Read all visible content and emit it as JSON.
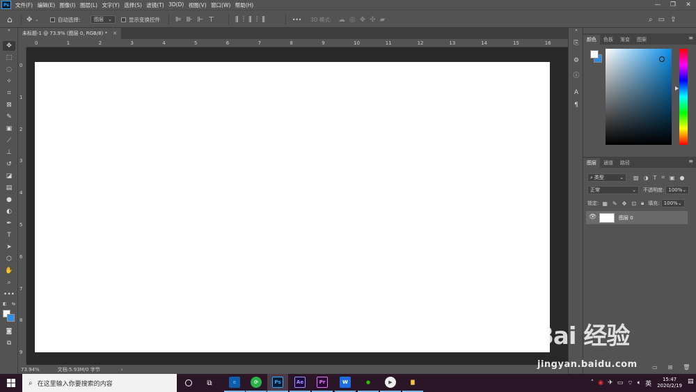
{
  "app": {
    "logo_text": "Ps",
    "menus": [
      "文件(F)",
      "编辑(E)",
      "图像(I)",
      "图层(L)",
      "文字(Y)",
      "选择(S)",
      "滤镜(T)",
      "3D(D)",
      "视图(V)",
      "窗口(W)",
      "帮助(H)"
    ]
  },
  "options_bar": {
    "auto_select_label": "自动选择:",
    "auto_select_target": "图层",
    "show_transform_label": "显示变换控件",
    "more_label": "•••",
    "mode_3d_label": "3D 模式:"
  },
  "document": {
    "tab_title": "未标题-1 @ 73.9% (图层 0, RGB/8) *",
    "zoom": "73.94%",
    "doc_info": "文档:5.93M/0 字节",
    "ruler_top": [
      "0",
      "1",
      "2",
      "3",
      "4",
      "5",
      "6",
      "7",
      "8",
      "9",
      "10",
      "11",
      "12",
      "13",
      "14",
      "15",
      "16"
    ],
    "ruler_left": [
      "0",
      "1",
      "2",
      "3",
      "4",
      "5",
      "6",
      "7",
      "8",
      "9"
    ],
    "canvas_color": "#ffffff"
  },
  "color_panel": {
    "tabs": [
      "颜色",
      "色板",
      "渐变",
      "图案"
    ],
    "foreground": "#ffffff",
    "background": "#2f8de4"
  },
  "layers_panel": {
    "tabs": [
      "图层",
      "通道",
      "路径"
    ],
    "filter_label": "类型",
    "blend_mode": "正常",
    "opacity_label": "不透明度:",
    "opacity_value": "100%",
    "lock_label": "锁定:",
    "fill_label": "填充:",
    "fill_value": "100%",
    "layers": [
      {
        "name": "图层 0",
        "visible": true
      }
    ]
  },
  "taskbar": {
    "search_placeholder": "在这里输入你要搜索的内容",
    "apps": [
      {
        "name": "edge",
        "label": "e",
        "bg": "#0f5ca8",
        "fg": "#3aa7f0"
      },
      {
        "name": "browser",
        "label": "⟳",
        "bg": "#2bb34a",
        "fg": "#ffffff"
      },
      {
        "name": "photoshop",
        "label": "Ps",
        "bg": "#001e36",
        "fg": "#31a8ff"
      },
      {
        "name": "after-effects",
        "label": "Ae",
        "bg": "#1f0740",
        "fg": "#9999ff"
      },
      {
        "name": "premiere",
        "label": "Pr",
        "bg": "#2a0634",
        "fg": "#e77bff"
      },
      {
        "name": "wps",
        "label": "W",
        "bg": "#1d6fe0",
        "fg": "#ffffff"
      },
      {
        "name": "wechat",
        "label": "●",
        "bg": "#2b1627",
        "fg": "#2dc100"
      },
      {
        "name": "player",
        "label": "▶",
        "bg": "#eeeeee",
        "fg": "#444444"
      },
      {
        "name": "explorer",
        "label": "▇",
        "bg": "#2b1627",
        "fg": "#f3c344"
      }
    ],
    "ime": "英",
    "time": "15:47",
    "date": "2020/2/19"
  },
  "watermark": {
    "logo": "Bai 经验",
    "url": "jingyan.baidu.com"
  }
}
